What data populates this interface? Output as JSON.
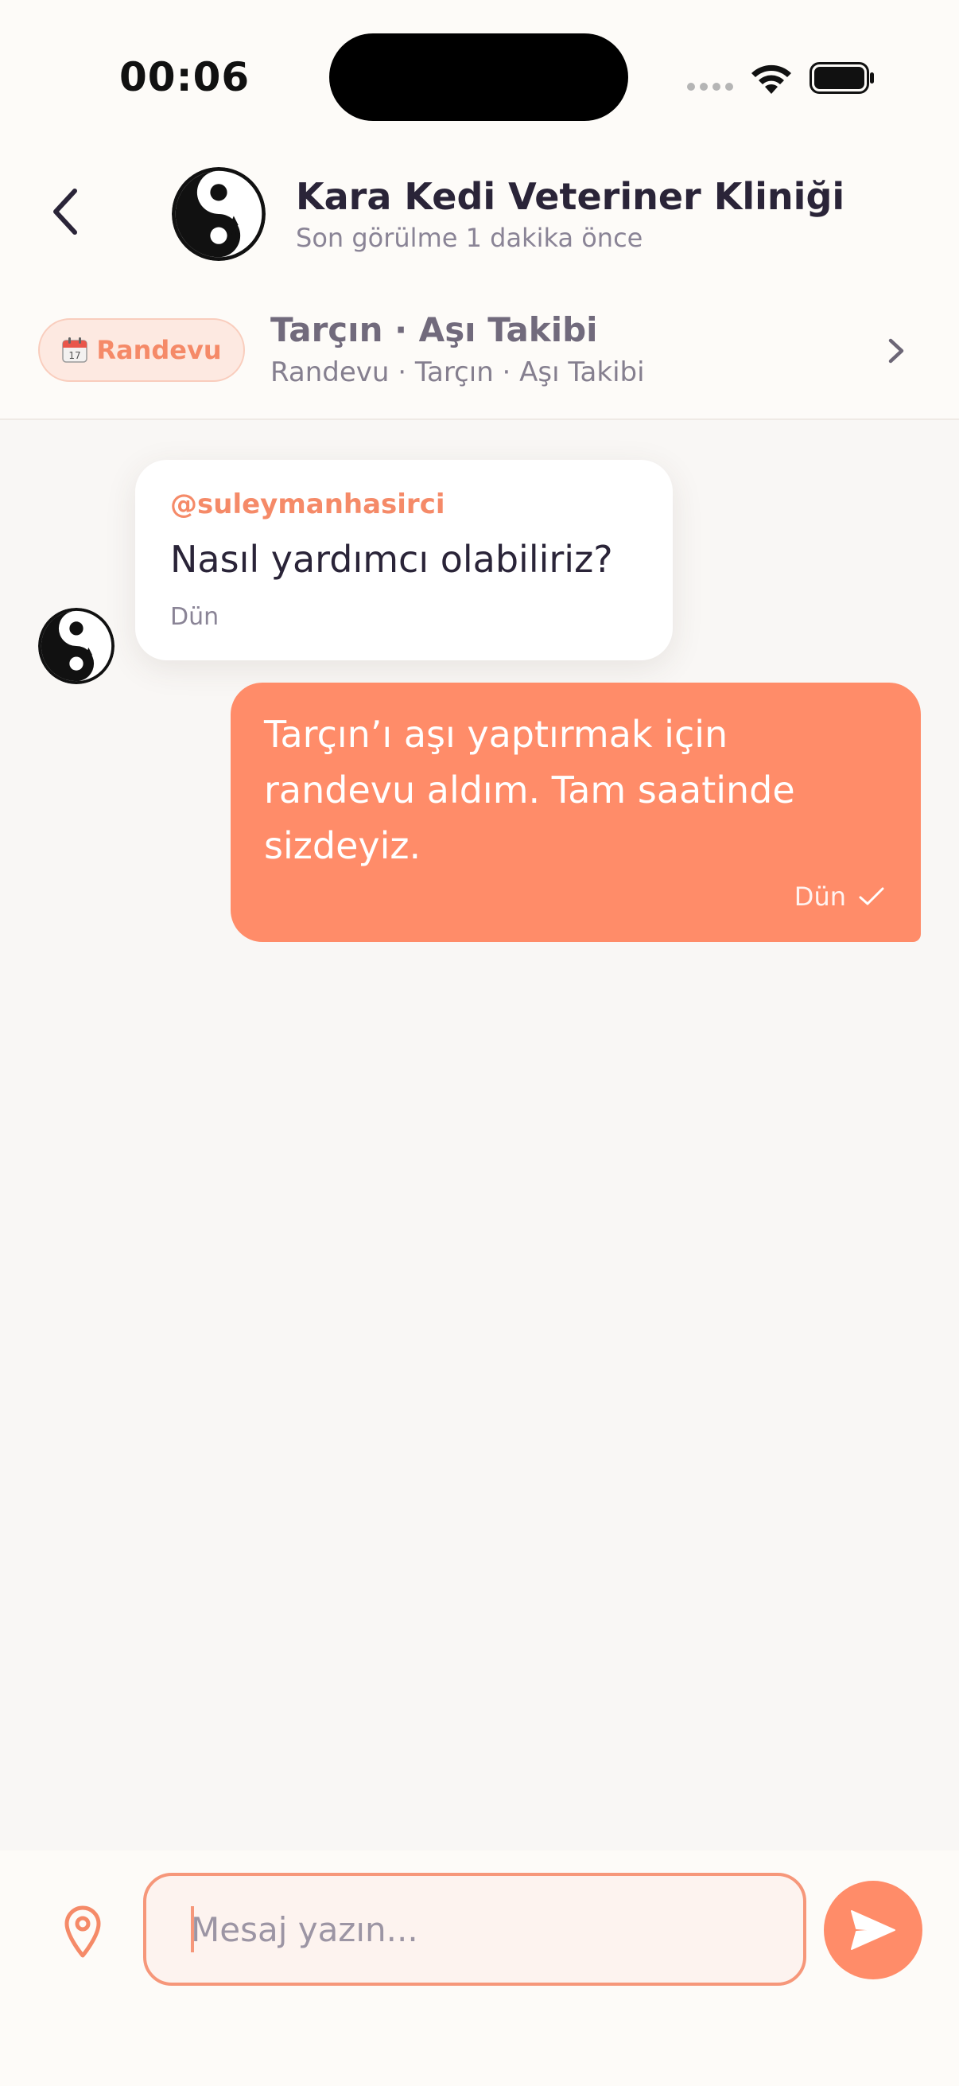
{
  "status_bar": {
    "time": "00:06"
  },
  "header": {
    "title": "Kara Kedi Veteriner Kliniği",
    "subtitle": "Son görülme 1 dakika önce"
  },
  "context": {
    "badge_label": "Randevu",
    "title": "Tarçın · Aşı Takibi",
    "subtitle": "Randevu · Tarçın · Aşı Takibi"
  },
  "messages": [
    {
      "direction": "incoming",
      "sender": "@suleymanhasirci",
      "text": "Nasıl yardımcı olabiliriz?",
      "time": "Dün"
    },
    {
      "direction": "outgoing",
      "text": "Tarçın’ı aşı yaptırmak için randevu aldım. Tam saatinde sizdeyiz.",
      "time": "Dün",
      "status_icon": "check-icon"
    }
  ],
  "composer": {
    "placeholder": "Mesaj yazın..."
  },
  "colors": {
    "accent": "#ff8c69",
    "accent_light": "#fde9e1",
    "text_primary": "#2a2438",
    "text_secondary": "#8a8496",
    "background": "#f9f7f5"
  }
}
